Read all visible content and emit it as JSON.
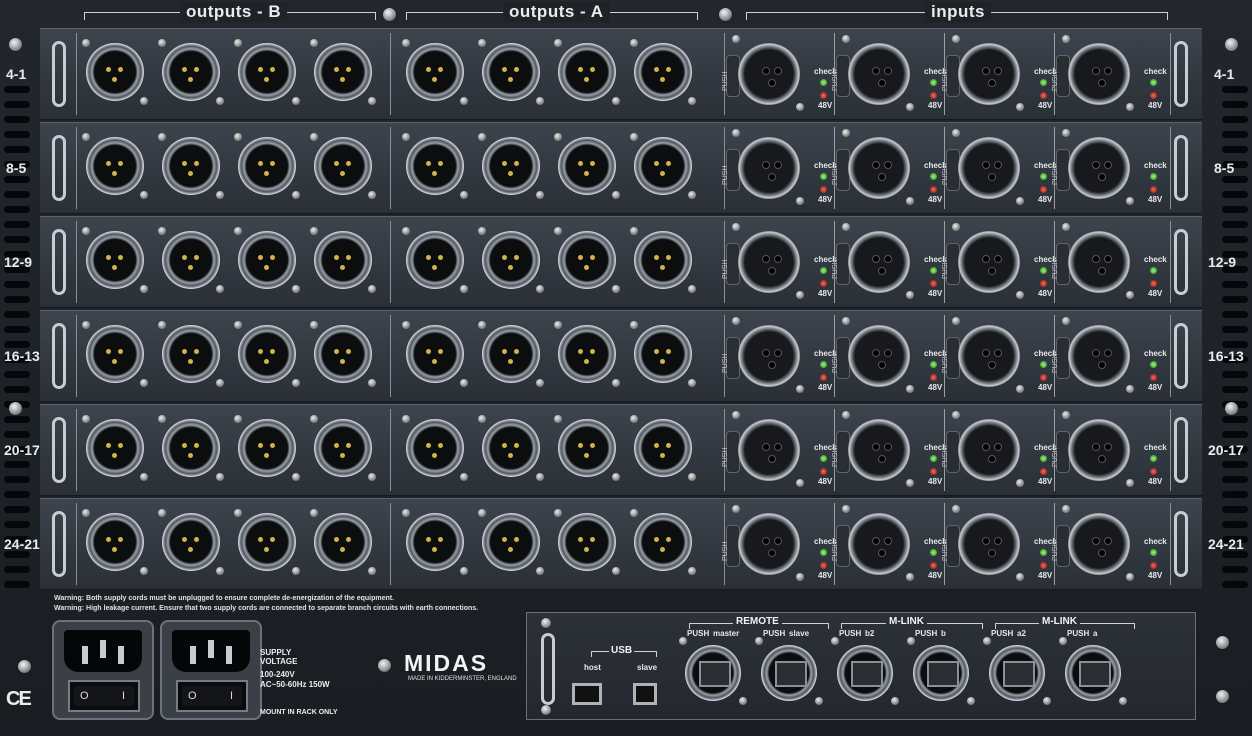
{
  "headers": {
    "outputs_b": "outputs - B",
    "outputs_a": "outputs - A",
    "inputs": "inputs"
  },
  "row_labels": [
    "4-1",
    "8-5",
    "12-9",
    "16-13",
    "20-17",
    "24-21"
  ],
  "input_labels": {
    "push": "PUSH",
    "check": "check",
    "phantom": "48V"
  },
  "warnings": {
    "line1": "Warning: Both supply cords must be unplugged to ensure complete de-energization of the equipment.",
    "line2": "Warning: High leakage current.  Ensure that two supply cords are connected to separate branch circuits with earth connections."
  },
  "power": {
    "supply_voltage_title": "SUPPLY VOLTAGE",
    "supply_line1": "100-240V",
    "supply_line2": "AC~50-60Hz 150W",
    "mount_note": "MOUNT IN RACK ONLY",
    "switch_on": "I",
    "switch_off": "O",
    "ce_mark": "CE"
  },
  "brand": {
    "logo": "MIDAS",
    "made_in": "MADE IN KIDDERMINSTER, ENGLAND"
  },
  "usb": {
    "title": "USB",
    "host": "host",
    "slave": "slave"
  },
  "network": {
    "groups": [
      "REMOTE",
      "M-LINK",
      "M-LINK"
    ],
    "ports": [
      {
        "push": "PUSH",
        "label": "master"
      },
      {
        "push": "PUSH",
        "label": "slave"
      },
      {
        "push": "PUSH",
        "label": "b2"
      },
      {
        "push": "PUSH",
        "label": "b"
      },
      {
        "push": "PUSH",
        "label": "a2"
      },
      {
        "push": "PUSH",
        "label": "a"
      }
    ]
  }
}
